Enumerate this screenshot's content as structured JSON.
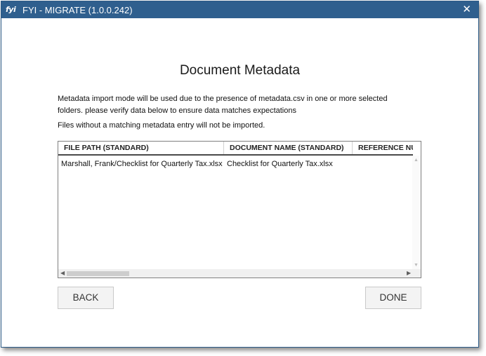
{
  "window": {
    "logo": "fyi",
    "title": "FYI - MIGRATE (1.0.0.242)",
    "close_glyph": "✕"
  },
  "page": {
    "heading": "Document Metadata",
    "description": "Metadata import mode will be used due to the presence of metadata.csv in one or more selected folders. please verify data below to ensure data matches expectations",
    "note": "Files without a matching metadata entry will not be imported."
  },
  "grid": {
    "columns": [
      "FILE PATH (STANDARD)",
      "DOCUMENT NAME (STANDARD)",
      "REFERENCE NU"
    ],
    "rows": [
      [
        "Marshall, Frank/Checklist for Quarterly Tax.xlsx",
        "Checklist for Quarterly Tax.xlsx",
        ""
      ]
    ],
    "icons": {
      "scroll_up": "▲",
      "scroll_down": "▼",
      "scroll_left": "◀",
      "scroll_right": "▶"
    }
  },
  "buttons": {
    "back": "BACK",
    "done": "DONE"
  },
  "colors": {
    "titlebar": "#2f5f8e",
    "border": "#2b5a86"
  }
}
